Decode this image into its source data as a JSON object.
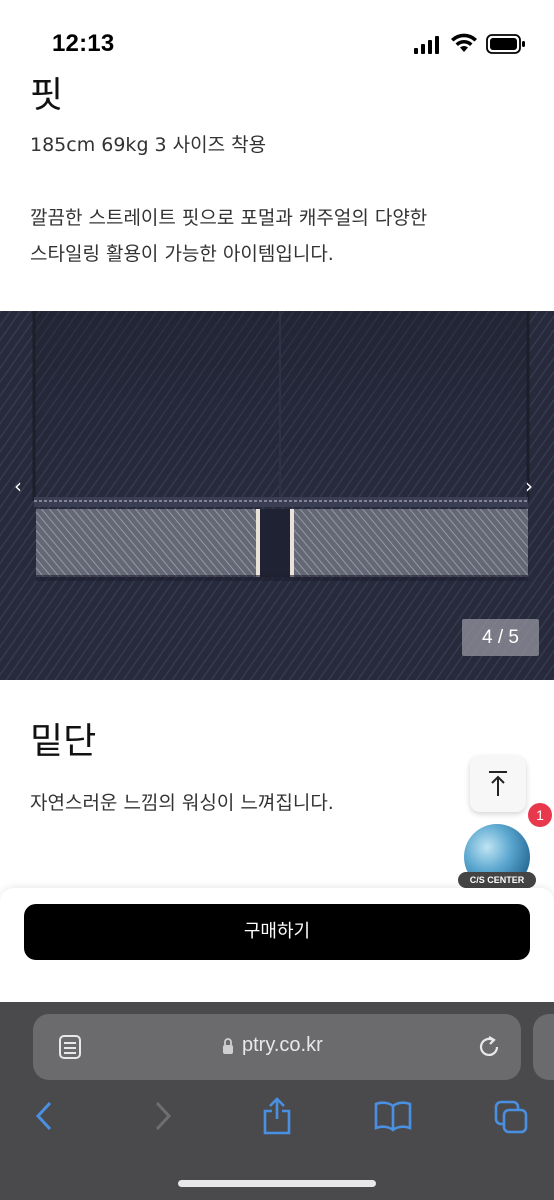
{
  "status_bar": {
    "time": "12:13"
  },
  "fit_section": {
    "title": "핏",
    "size_info": "185cm 69kg 3 사이즈 착용",
    "description_line1": "깔끔한 스트레이트 핏으로 포멀과 캐주얼의 다양한",
    "description_line2": "스타일링 활용이 가능한 아이템입니다."
  },
  "carousel": {
    "counter": "4 / 5",
    "prev_icon": "chevron-left-icon",
    "next_icon": "chevron-right-icon"
  },
  "hem_section": {
    "title": "밑단",
    "description": "자연스러운 느낌의 워싱이 느껴집니다."
  },
  "floating": {
    "scroll_top_icon": "arrow-up-to-top-icon",
    "cs_label": "C/S CENTER",
    "cs_badge_count": "1"
  },
  "purchase": {
    "buy_label": "구매하기"
  },
  "browser": {
    "url": "ptry.co.kr",
    "icons": [
      "reader-icon",
      "lock-icon",
      "reload-icon",
      "back-icon",
      "forward-icon",
      "share-icon",
      "bookmarks-icon",
      "tabs-icon"
    ],
    "accent_color": "#4a90e2"
  }
}
